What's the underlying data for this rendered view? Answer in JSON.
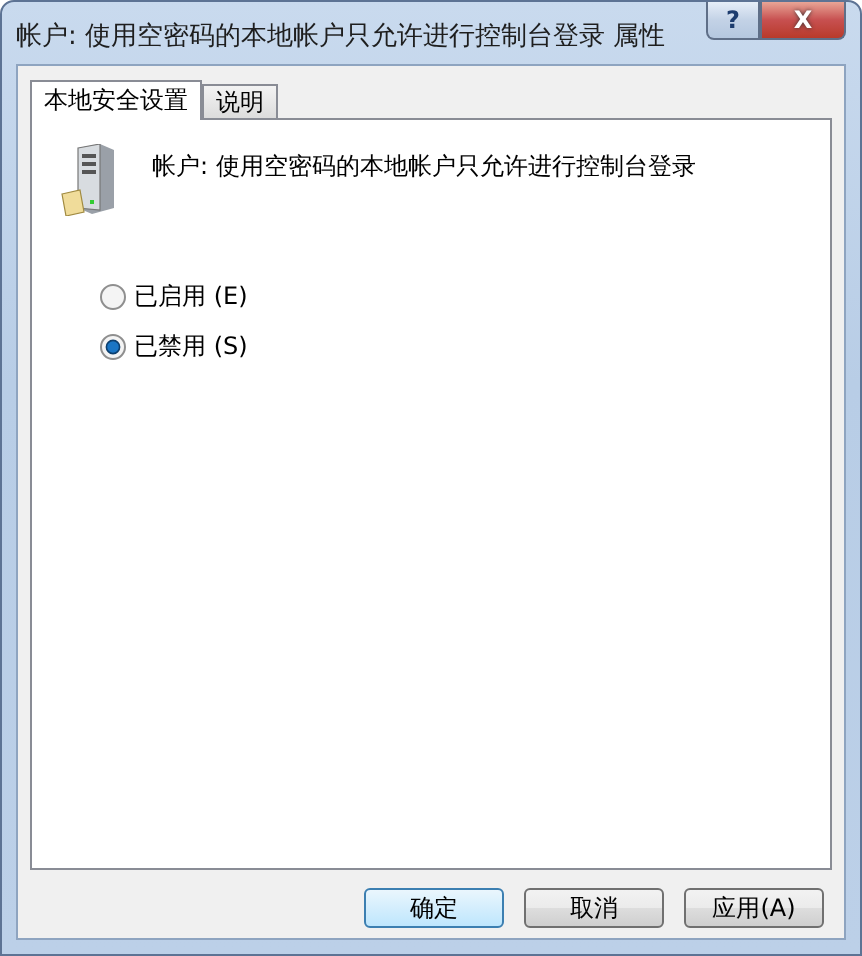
{
  "window": {
    "title": "帐户: 使用空密码的本地帐户只允许进行控制台登录 属性"
  },
  "title_buttons": [
    {
      "kind": "help",
      "label": "?"
    },
    {
      "kind": "close",
      "label": "X"
    }
  ],
  "tabs": [
    {
      "label": "本地安全设置",
      "selected": true
    },
    {
      "label": "说明",
      "selected": false
    }
  ],
  "policy": {
    "heading": "帐户:  使用空密码的本地帐户只允许进行控制台登录"
  },
  "options": [
    {
      "label": "已启用 (E)",
      "selected": false
    },
    {
      "label": "已禁用 (S)",
      "selected": true
    }
  ],
  "buttons": [
    {
      "label": "确定",
      "default": true
    },
    {
      "label": "取消",
      "default": false
    },
    {
      "label": "应用(A)",
      "default": false
    }
  ]
}
